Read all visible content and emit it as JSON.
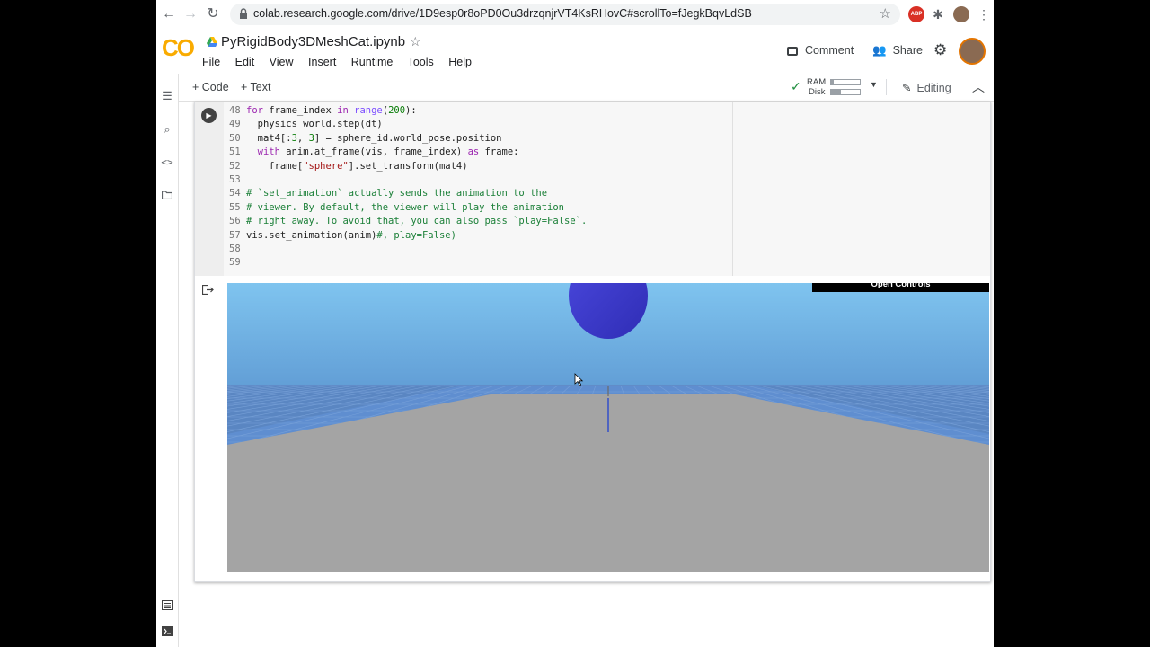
{
  "browser": {
    "url": "colab.research.google.com/drive/1D9esp0r8oPD0Ou3drzqnjrVT4KsRHovC#scrollTo=fJegkBqvLdSB",
    "ext_label": "ABP"
  },
  "colab": {
    "logo": "CO",
    "notebook_title": "PyRigidBody3DMeshCat.ipynb",
    "menu": [
      "File",
      "Edit",
      "View",
      "Insert",
      "Runtime",
      "Tools",
      "Help"
    ],
    "comment_label": "Comment",
    "share_label": "Share"
  },
  "toolbar": {
    "add_code": "+ Code",
    "add_text": "+ Text",
    "ram_label": "RAM",
    "disk_label": "Disk",
    "ram_fraction": 0.1,
    "disk_fraction": 0.35,
    "editing_label": "Editing"
  },
  "code_lines": [
    {
      "n": "48",
      "html": "<span class=\"kw\">for</span> frame_index <span class=\"kw\">in</span> <span class=\"bi\">range</span>(<span class=\"num\">200</span>):"
    },
    {
      "n": "49",
      "html": "  physics_world.step(dt)"
    },
    {
      "n": "50",
      "html": "  mat4[:<span class=\"num\">3</span>, <span class=\"num\">3</span>] = sphere_id.world_pose.position"
    },
    {
      "n": "51",
      "html": "  <span class=\"kw\">with</span> anim.at_frame(vis, frame_index) <span class=\"kw\">as</span> frame:"
    },
    {
      "n": "52",
      "html": "    frame[<span class=\"str\">\"sphere\"</span>].set_transform(mat4)"
    },
    {
      "n": "53",
      "html": ""
    },
    {
      "n": "54",
      "html": "<span class=\"cmt\"># `set_animation` actually sends the animation to the</span>"
    },
    {
      "n": "55",
      "html": "<span class=\"cmt\"># viewer. By default, the viewer will play the animation</span>"
    },
    {
      "n": "56",
      "html": "<span class=\"cmt\"># right away. To avoid that, you can also pass `play=False`.</span>"
    },
    {
      "n": "57",
      "html": "vis.set_animation(anim)<span class=\"cmt\">#, play=False)</span>"
    },
    {
      "n": "58",
      "html": ""
    },
    {
      "n": "59",
      "html": ""
    }
  ],
  "viewer": {
    "open_controls": "Open Controls"
  },
  "colors": {
    "sky_top": "#7fc4ef",
    "sky_bottom": "#4f86c6",
    "ground": "#a4a4a4",
    "sphere": "#3a38c8",
    "logo": "#f9ab00"
  }
}
